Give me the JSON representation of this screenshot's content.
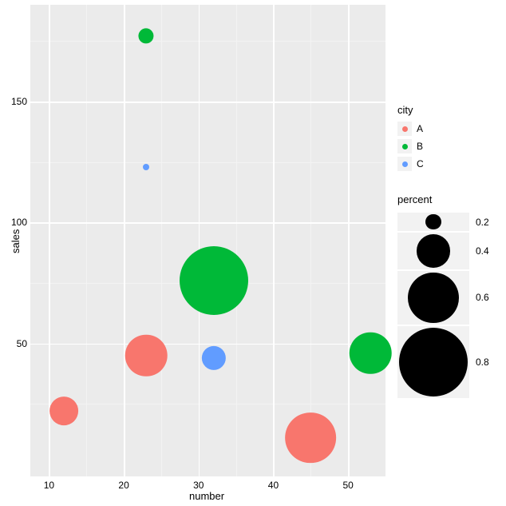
{
  "chart_data": {
    "type": "scatter",
    "xlabel": "number",
    "ylabel": "sales",
    "xlim": [
      7.5,
      55
    ],
    "ylim": [
      -5,
      190
    ],
    "x_ticks": [
      10,
      20,
      30,
      40,
      50
    ],
    "y_ticks": [
      50,
      100,
      150
    ],
    "x_minor": [
      15,
      25,
      35,
      45
    ],
    "y_minor": [
      25,
      75,
      125,
      175
    ],
    "series": [
      {
        "name": "A",
        "color": "#f8766d",
        "points": [
          {
            "x": 12,
            "y": 22,
            "percent": 0.35
          },
          {
            "x": 23,
            "y": 45,
            "percent": 0.5
          },
          {
            "x": 45,
            "y": 11,
            "percent": 0.6
          }
        ]
      },
      {
        "name": "B",
        "color": "#00b938",
        "points": [
          {
            "x": 23,
            "y": 177,
            "percent": 0.2
          },
          {
            "x": 32,
            "y": 76,
            "percent": 0.8
          },
          {
            "x": 53,
            "y": 46,
            "percent": 0.5
          }
        ]
      },
      {
        "name": "C",
        "color": "#619cff",
        "points": [
          {
            "x": 23,
            "y": 123,
            "percent": 0.1
          },
          {
            "x": 32,
            "y": 44,
            "percent": 0.3
          }
        ]
      }
    ],
    "legend_color": {
      "title": "city",
      "items": [
        "A",
        "B",
        "C"
      ]
    },
    "legend_size": {
      "title": "percent",
      "items": [
        0.2,
        0.4,
        0.6,
        0.8
      ]
    }
  },
  "axis": {
    "x": "number",
    "y": "sales"
  },
  "legend_titles": {
    "color": "city",
    "size": "percent"
  }
}
